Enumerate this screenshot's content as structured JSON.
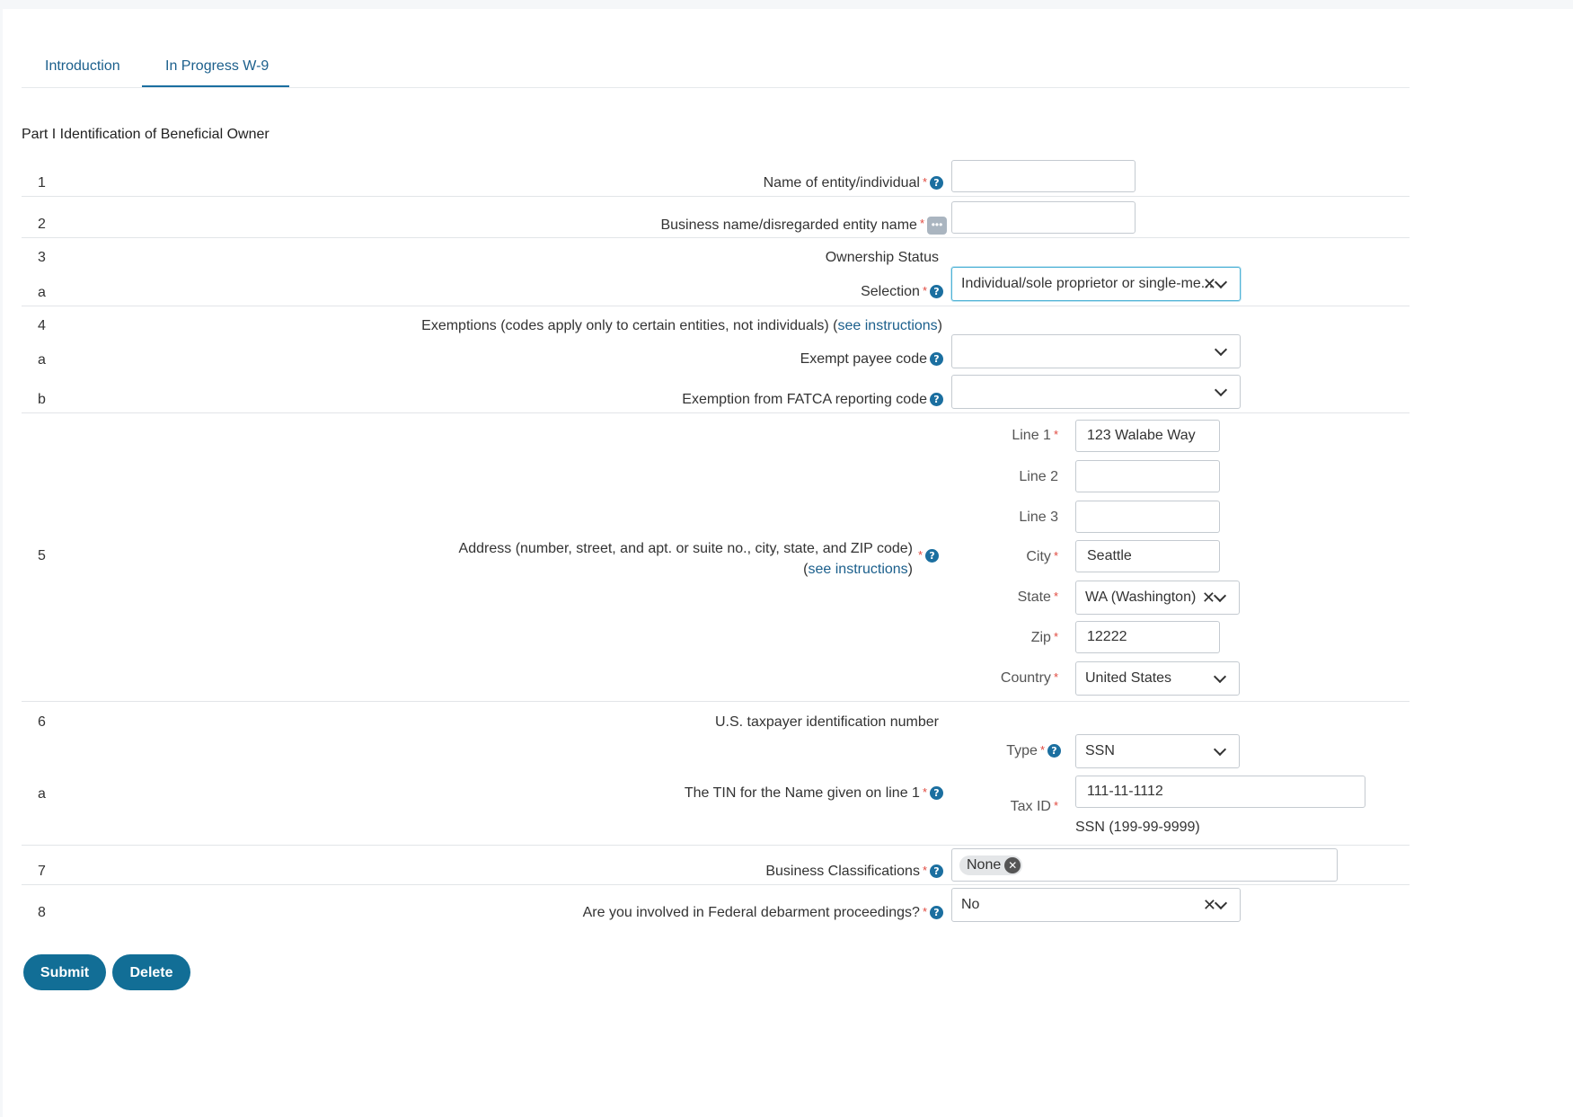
{
  "tabs": [
    {
      "label": "Introduction"
    },
    {
      "label": "In Progress W-9"
    }
  ],
  "section_title": "Part I Identification of Beneficial Owner",
  "rows": {
    "r1": {
      "num": "1",
      "label": "Name of entity/individual",
      "value": ""
    },
    "r2": {
      "num": "2",
      "label": "Business name/disregarded entity name",
      "value": ""
    },
    "r3": {
      "num": "3",
      "label": "Ownership Status"
    },
    "r3a": {
      "num": "a",
      "label": "Selection",
      "value": "Individual/sole proprietor or single-me..."
    },
    "r4": {
      "num": "4",
      "label": "Exemptions (codes apply only to certain entities, not individuals) (",
      "link": "see instructions",
      "close": ")"
    },
    "r4a": {
      "num": "a",
      "label": "Exempt payee code",
      "value": ""
    },
    "r4b": {
      "num": "b",
      "label": "Exemption from FATCA reporting code",
      "value": ""
    },
    "r5": {
      "num": "5",
      "label": "Address (number, street, and apt. or suite no., city, state, and ZIP code)",
      "link_open": "(",
      "link": "see instructions",
      "link_close": ")",
      "line1_label": "Line 1",
      "line1": "123 Walabe Way",
      "line2_label": "Line 2",
      "line2": "",
      "line3_label": "Line 3",
      "line3": "",
      "city_label": "City",
      "city": "Seattle",
      "state_label": "State",
      "state": "WA (Washington)",
      "zip_label": "Zip",
      "zip": "12222",
      "country_label": "Country",
      "country": "United States"
    },
    "r6": {
      "num": "6",
      "label": "U.S. taxpayer identification number"
    },
    "r6a": {
      "num": "a",
      "label": "The TIN for the Name given on line 1",
      "type_label": "Type",
      "type": "SSN",
      "taxid_label": "Tax ID",
      "taxid": "111-11-1112",
      "hint": "SSN (199-99-9999)"
    },
    "r7": {
      "num": "7",
      "label": "Business Classifications",
      "chip": "None"
    },
    "r8": {
      "num": "8",
      "label": "Are you involved in Federal debarment proceedings?",
      "value": "No"
    }
  },
  "symbols": {
    "required": "*",
    "help": "?",
    "more": "•••",
    "clear": "✕",
    "chip_remove": "✕"
  },
  "buttons": {
    "submit": "Submit",
    "delete": "Delete"
  },
  "colors": {
    "accent": "#126e96",
    "link": "#1b5f8c",
    "required": "#e0493f",
    "focus": "#4fb3d6"
  }
}
